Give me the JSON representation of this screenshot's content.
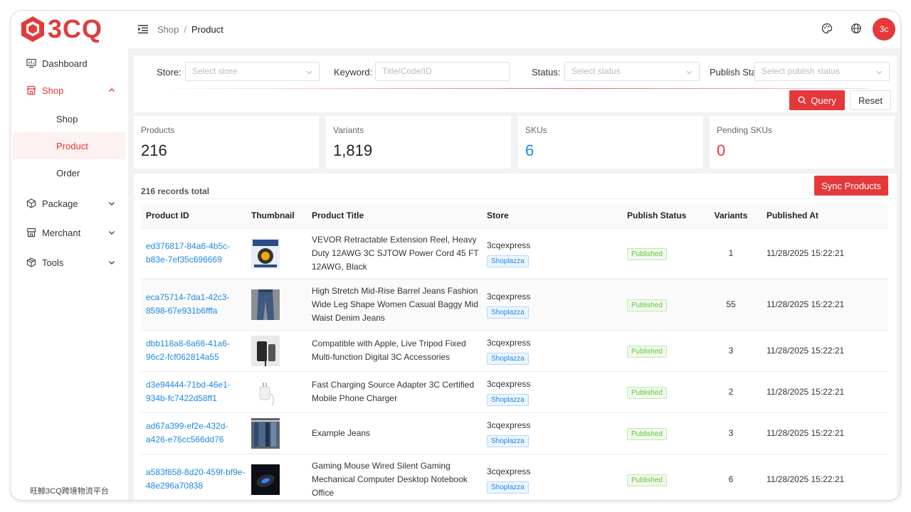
{
  "app": {
    "logo_text": "3CQ",
    "footer": "旺鯨3CQ跨境物流平台",
    "accent": "#e5383b",
    "avatar": "3c"
  },
  "breadcrumb": {
    "parent": "Shop",
    "separator": "/",
    "current": "Product"
  },
  "header_icons": [
    "palette-icon",
    "globe-icon"
  ],
  "sidebar": {
    "items": [
      {
        "label": "Dashboard",
        "icon": "dashboard-icon"
      },
      {
        "label": "Shop",
        "icon": "shop-icon",
        "expanded": true,
        "children": [
          {
            "label": "Shop"
          },
          {
            "label": "Product",
            "active": true
          },
          {
            "label": "Order"
          }
        ]
      },
      {
        "label": "Package",
        "icon": "package-icon"
      },
      {
        "label": "Merchant",
        "icon": "merchant-icon"
      },
      {
        "label": "Tools",
        "icon": "tools-icon"
      }
    ]
  },
  "filters": {
    "store_label": "Store",
    "store_placeholder": "Select store",
    "keyword_label": "Keyword",
    "keyword_placeholder": "Title/Code/ID",
    "status_label": "Status",
    "status_placeholder": "Select status",
    "publish_label": "Publish Stat",
    "publish_placeholder": "Select publish status",
    "query": "Query",
    "reset": "Reset"
  },
  "stats": [
    {
      "label": "Products",
      "value": "216",
      "color": "#222222"
    },
    {
      "label": "Variants",
      "value": "1,819",
      "color": "#222222"
    },
    {
      "label": "SKUs",
      "value": "6",
      "color": "#1e88e5"
    },
    {
      "label": "Pending SKUs",
      "value": "0",
      "color": "#e5383b"
    }
  ],
  "table": {
    "records_total": "216 records total",
    "sync_button": "Sync Products",
    "columns": [
      "Product ID",
      "Thumbnail",
      "Product Title",
      "Store",
      "Publish Status",
      "Variants",
      "Published At"
    ],
    "rows": [
      {
        "id": "ed376817-84a6-4b5c-b83e-7ef35c696669",
        "title": "VEVOR Retractable Extension Reel, Heavy Duty 12AWG 3C SJTOW Power Cord 45 FT 12AWG, Black",
        "store": "3cqexpress",
        "platform": "Shoplazza",
        "status": "Published",
        "variants": "1",
        "published_at": "11/28/2025 15:22:21"
      },
      {
        "id": "eca75714-7da1-42c3-8598-67e931b6fffa",
        "title": "High Stretch Mid-Rise Barrel Jeans Fashion Wide Leg Shape Women Casual Baggy Mid Waist Denim Jeans",
        "store": "3cqexpress",
        "platform": "Shoplazza",
        "status": "Published",
        "variants": "55",
        "published_at": "11/28/2025 15:22:21"
      },
      {
        "id": "dbb118a8-6a66-41a6-96c2-fcf062814a55",
        "title": "Compatible with Apple, Live Tripod Fixed Multi-function Digital 3C Accessories",
        "store": "3cqexpress",
        "platform": "Shoplazza",
        "status": "Published",
        "variants": "3",
        "published_at": "11/28/2025 15:22:21"
      },
      {
        "id": "d3e94444-71bd-46e1-934b-fc7422d58ff1",
        "title": "Fast Charging Source Adapter 3C Certified Mobile Phone Charger",
        "store": "3cqexpress",
        "platform": "Shoplazza",
        "status": "Published",
        "variants": "2",
        "published_at": "11/28/2025 15:22:21"
      },
      {
        "id": "ad67a399-ef2e-432d-a426-e76cc566dd76",
        "title": "Example Jeans",
        "store": "3cqexpress",
        "platform": "Shoplazza",
        "status": "Published",
        "variants": "3",
        "published_at": "11/28/2025 15:22:21"
      },
      {
        "id": "a583f858-8d20-459f-bf9e-48e296a70838",
        "title": "Gaming Mouse Wired Silent Gaming Mechanical Computer Desktop Notebook Office",
        "store": "3cqexpress",
        "platform": "Shoplazza",
        "status": "Published",
        "variants": "6",
        "published_at": "11/28/2025 15:22:21"
      }
    ]
  }
}
